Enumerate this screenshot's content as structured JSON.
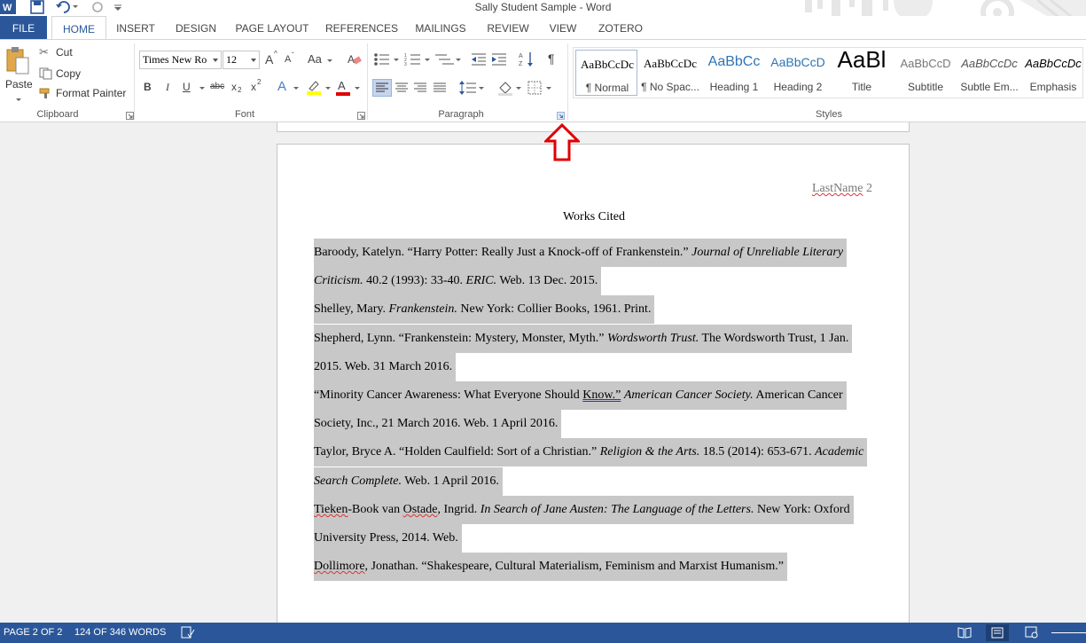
{
  "app": {
    "title": "Sally Student Sample - Word"
  },
  "tabs": [
    "FILE",
    "HOME",
    "INSERT",
    "DESIGN",
    "PAGE LAYOUT",
    "REFERENCES",
    "MAILINGS",
    "REVIEW",
    "VIEW",
    "ZOTERO"
  ],
  "active_tab": "HOME",
  "clipboard": {
    "paste": "Paste",
    "cut": "Cut",
    "copy": "Copy",
    "format_painter": "Format Painter",
    "label": "Clipboard"
  },
  "font": {
    "name": "Times New Ro",
    "size": "12",
    "label": "Font",
    "bold": "B",
    "italic": "I",
    "underline": "U",
    "strike": "abc",
    "sub": "x",
    "sub_mark": "2",
    "sup": "x",
    "sup_mark": "2",
    "grow": "A",
    "shrink": "A",
    "change_case": "Aa",
    "font_color_letter": "A",
    "text_effects_letter": "A",
    "highlight_color": "#ffff00",
    "font_color": "#e00000"
  },
  "paragraph": {
    "label": "Paragraph",
    "show_marks": "¶"
  },
  "styles": {
    "label": "Styles",
    "items": [
      {
        "preview": "AaBbCcDc",
        "name": "¶ Normal"
      },
      {
        "preview": "AaBbCcDc",
        "name": "¶ No Spac..."
      },
      {
        "preview": "AaBbCc",
        "name": "Heading 1"
      },
      {
        "preview": "AaBbCcD",
        "name": "Heading 2"
      },
      {
        "preview": "AaBl",
        "name": "Title"
      },
      {
        "preview": "AaBbCcD",
        "name": "Subtitle"
      },
      {
        "preview": "AaBbCcDc",
        "name": "Subtle Em..."
      },
      {
        "preview": "AaBbCcDc",
        "name": "Emphasis"
      }
    ]
  },
  "document": {
    "header_name": "LastName",
    "header_page": " 2",
    "heading": "Works Cited",
    "lines": [
      {
        "segs": [
          {
            "t": "Baroody, Katelyn. “Harry Potter: Really Just a Knock-off of Frankenstein.” "
          },
          {
            "t": "Journal of Unreliable Literary",
            "i": true
          }
        ]
      },
      {
        "segs": [
          {
            "t": "Criticism.",
            "i": true
          },
          {
            "t": " 40.2 (1993): 33-40. "
          },
          {
            "t": "ERIC.",
            "i": true
          },
          {
            "t": " Web. 13 Dec. 2015."
          }
        ]
      },
      {
        "segs": [
          {
            "t": "Shelley, Mary. "
          },
          {
            "t": "Frankenstein.",
            "i": true
          },
          {
            "t": " New York: Collier Books, 1961. Print."
          }
        ]
      },
      {
        "segs": [
          {
            "t": "Shepherd, Lynn. “Frankenstein: Mystery, Monster, Myth.” "
          },
          {
            "t": "Wordsworth Trust.",
            "i": true
          },
          {
            "t": " The Wordsworth Trust, 1 Jan."
          }
        ]
      },
      {
        "segs": [
          {
            "t": "2015. Web. 31 March 2016."
          }
        ]
      },
      {
        "segs": [
          {
            "t": "“Minority Cancer Awareness: What Everyone Should "
          },
          {
            "t": "Know.”",
            "g": true
          },
          {
            "t": " "
          },
          {
            "t": "American Cancer Society.",
            "i": true
          },
          {
            "t": " American Cancer"
          }
        ]
      },
      {
        "segs": [
          {
            "t": "Society, Inc., 21 March 2016. Web. 1 April 2016."
          }
        ]
      },
      {
        "segs": [
          {
            "t": "Taylor, Bryce A. “Holden Caulfield: Sort of a Christian.” "
          },
          {
            "t": "Religion & the Arts.",
            "i": true
          },
          {
            "t": " 18.5 (2014): 653-671. "
          },
          {
            "t": "Academic",
            "i": true
          }
        ]
      },
      {
        "segs": [
          {
            "t": "Search Complete.",
            "i": true
          },
          {
            "t": " Web. 1 April 2016."
          }
        ]
      },
      {
        "segs": [
          {
            "t": "Tieken",
            "s": true
          },
          {
            "t": "-Book van "
          },
          {
            "t": "Ostade",
            "s": true
          },
          {
            "t": ", Ingrid. "
          },
          {
            "t": "In Search of Jane Austen: The Language of the Letters.",
            "i": true
          },
          {
            "t": " New York: Oxford"
          }
        ]
      },
      {
        "segs": [
          {
            "t": "University Press, 2014. Web."
          }
        ]
      },
      {
        "segs": [
          {
            "t": "Dollimore",
            "s": true
          },
          {
            "t": ", Jonathan. “Shakespeare, Cultural Materialism, Feminism and Marxist Humanism.”"
          }
        ]
      }
    ]
  },
  "status": {
    "page": "PAGE 2 OF 2",
    "words": "124 OF 346 WORDS"
  },
  "colors": {
    "accent": "#2b579a",
    "callout": "#e00000",
    "selection": "#c8c8c8"
  }
}
